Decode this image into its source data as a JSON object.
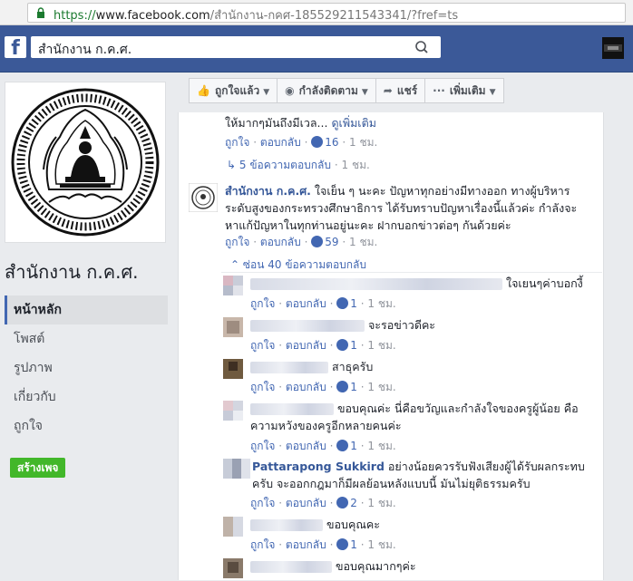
{
  "browser": {
    "url_scheme": "https://",
    "url_domain": "www.facebook.com",
    "url_path": "/สำนักงาน-กคศ-185529211543341/?fref=ts"
  },
  "topbar": {
    "logo_letter": "f",
    "search_value": "สำนักงาน ก.ค.ศ."
  },
  "sidebar": {
    "page_name": "สำนักงาน ก.ค.ศ.",
    "nav": [
      {
        "label": "หน้าหลัก"
      },
      {
        "label": "โพสต์"
      },
      {
        "label": "รูปภาพ"
      },
      {
        "label": "เกี่ยวกับ"
      },
      {
        "label": "ถูกใจ"
      }
    ],
    "create_page": "สร้างเพจ"
  },
  "actions": {
    "liked": "ถูกใจแล้ว",
    "following": "กำลังติดตาม",
    "share": "แชร์",
    "more": "เพิ่มเติม"
  },
  "common": {
    "like": "ถูกใจ",
    "reply": "ตอบกลับ",
    "dot": "·",
    "time": "1 ชม."
  },
  "comment1": {
    "text": "ให้มากๆมันถึงมีเวล...",
    "see_more": "ดูเพิ่มเติม",
    "likes": "16",
    "replies_link": "5 ข้อความตอบกลับ",
    "replies_time": "1 ชม."
  },
  "comment2": {
    "author": "สำนักงาน ก.ค.ศ.",
    "text_line1": "ใจเย็น ๆ นะคะ ปัญหาทุกอย่างมีทางออก ทางผู้บริหาร",
    "text_line2": "ระดับสูงของกระทรวงศึกษาธิการ ได้รับทราบปัญหาเรื่องนี้แล้วค่ะ กำลังจะ",
    "text_line3": "หาแก้ปัญหาในทุกท่านอยู่นะคะ ฝากบอกข่าวต่อๆ กันด้วยค่ะ",
    "likes": "59",
    "hide_replies": "ซ่อน 40 ข้อความตอบกลับ"
  },
  "replies": [
    {
      "text": "ใจเยนๆค่าบอกงี้",
      "likes": "1"
    },
    {
      "text": "จะรอข่าวดีคะ",
      "likes": "1"
    },
    {
      "text": "สาธุครับ",
      "likes": "1"
    },
    {
      "text_line1": "ขอบคุณค่ะ นี่คือขวัญและกำลังใจของครูผู้น้อย คือ",
      "text_line2": "ความหวังของครูอีกหลายคนค่ะ",
      "likes": "1"
    },
    {
      "author": "Pattarapong Sukkird",
      "text_line1": "อย่างน้อยควรรับฟังเสียงผู้ได้รับผลกระทบ",
      "text_line2": "ครับ จะออกกฎมาก็มีผลย้อนหลังแบบนี้ มันไม่ยุติธรรมครับ",
      "likes": "2"
    },
    {
      "text": "ขอบคุณคะ",
      "likes": "1"
    },
    {
      "text": "ขอบคุณมากๆค่ะ"
    }
  ]
}
